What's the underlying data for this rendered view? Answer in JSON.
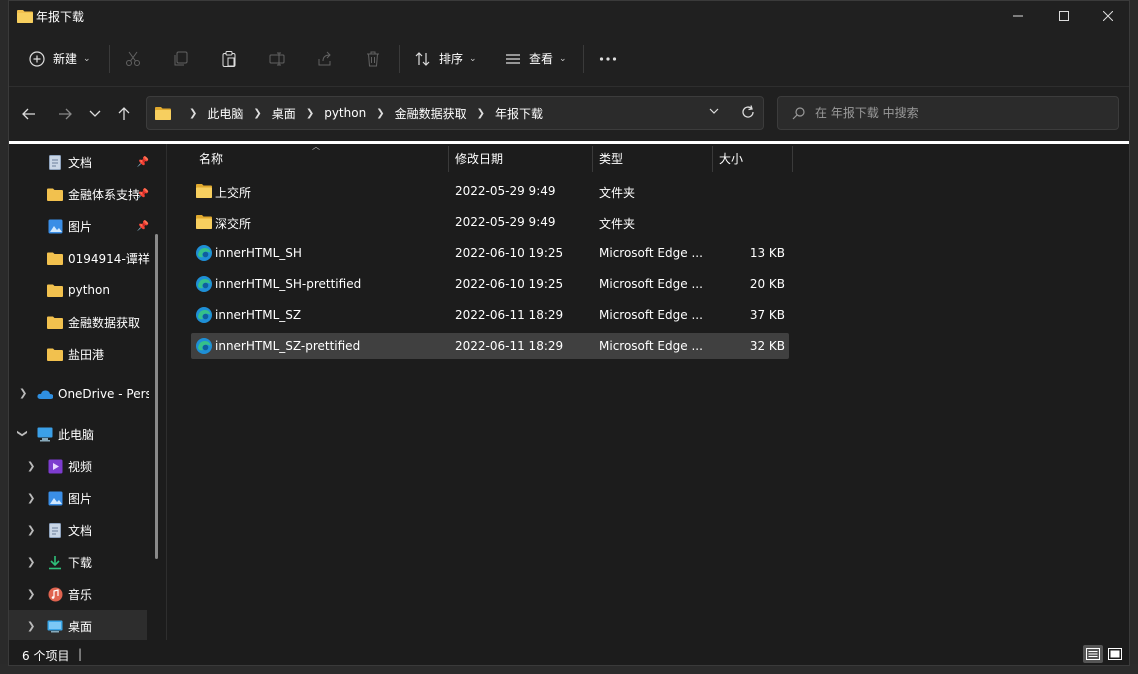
{
  "window": {
    "title": "年报下载"
  },
  "toolbar": {
    "new_label": "新建",
    "sort_label": "排序",
    "view_label": "查看"
  },
  "breadcrumb": [
    "此电脑",
    "桌面",
    "python",
    "金融数据获取",
    "年报下载"
  ],
  "search": {
    "placeholder": "在 年报下载 中搜索"
  },
  "sidebar": {
    "quick": [
      {
        "label": "文档",
        "icon": "document-icon",
        "pinned": true
      },
      {
        "label": "金融体系支持",
        "icon": "folder-icon",
        "pinned": true
      },
      {
        "label": "图片",
        "icon": "pictures-icon",
        "pinned": true
      },
      {
        "label": "0194914-谭祥",
        "icon": "folder-icon",
        "pinned": false
      },
      {
        "label": "python",
        "icon": "folder-icon",
        "pinned": false
      },
      {
        "label": "金融数据获取",
        "icon": "folder-icon",
        "pinned": false
      },
      {
        "label": "盐田港",
        "icon": "folder-icon",
        "pinned": false
      }
    ],
    "onedrive": "OneDrive - Pers",
    "thispc": "此电脑",
    "pc_items": [
      {
        "label": "视频",
        "icon": "videos-icon"
      },
      {
        "label": "图片",
        "icon": "pictures-icon"
      },
      {
        "label": "文档",
        "icon": "document-icon"
      },
      {
        "label": "下载",
        "icon": "downloads-icon"
      },
      {
        "label": "音乐",
        "icon": "music-icon"
      },
      {
        "label": "桌面",
        "icon": "desktop-icon"
      }
    ]
  },
  "columns": {
    "name": "名称",
    "date": "修改日期",
    "type": "类型",
    "size": "大小"
  },
  "files": [
    {
      "name": "上交所",
      "date": "2022-05-29 9:49",
      "type": "文件夹",
      "size": "",
      "icon": "folder-icon"
    },
    {
      "name": "深交所",
      "date": "2022-05-29 9:49",
      "type": "文件夹",
      "size": "",
      "icon": "folder-icon"
    },
    {
      "name": "innerHTML_SH",
      "date": "2022-06-10 19:25",
      "type": "Microsoft Edge ...",
      "size": "13 KB",
      "icon": "edge-icon"
    },
    {
      "name": "innerHTML_SH-prettified",
      "date": "2022-06-10 19:25",
      "type": "Microsoft Edge ...",
      "size": "20 KB",
      "icon": "edge-icon"
    },
    {
      "name": "innerHTML_SZ",
      "date": "2022-06-11 18:29",
      "type": "Microsoft Edge ...",
      "size": "37 KB",
      "icon": "edge-icon"
    },
    {
      "name": "innerHTML_SZ-prettified",
      "date": "2022-06-11 18:29",
      "type": "Microsoft Edge ...",
      "size": "32 KB",
      "icon": "edge-icon"
    }
  ],
  "status": {
    "count": "6 个项目",
    "cursor": "|"
  },
  "colors": {
    "folder": "#f2c14e",
    "selected_row": "#404040",
    "edge_blue": "#1e8fd6",
    "edge_green": "#35c08a"
  }
}
